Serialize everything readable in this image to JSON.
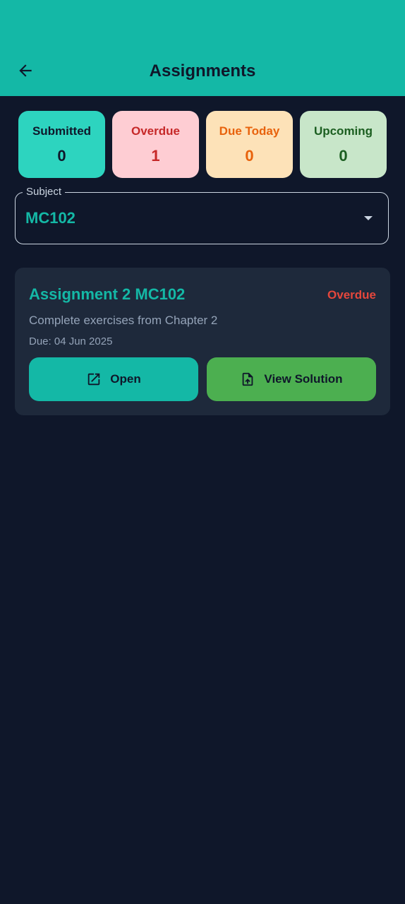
{
  "colors": {
    "appbar": "#14b8a6",
    "background": "#0f172a",
    "card": "#1e293b",
    "accent": "#14b8a6",
    "overdue": "#e5473c",
    "solution_button": "#4caf50"
  },
  "header": {
    "title": "Assignments",
    "back_icon": "arrow-left-icon"
  },
  "stats": [
    {
      "label": "Submitted",
      "value": "0",
      "bg": "#2dd4bf",
      "fg": "#0f172a"
    },
    {
      "label": "Overdue",
      "value": "1",
      "bg": "#fecdd3",
      "fg": "#c62828"
    },
    {
      "label": "Due Today",
      "value": "0",
      "bg": "#fde2b8",
      "fg": "#e8620c"
    },
    {
      "label": "Upcoming",
      "value": "0",
      "bg": "#c8e6c9",
      "fg": "#1b5e20"
    }
  ],
  "subject": {
    "label": "Subject",
    "value": "MC102",
    "icon": "dropdown-arrow-icon"
  },
  "assignments": [
    {
      "title": "Assignment 2 MC102",
      "status": "Overdue",
      "description": "Complete exercises from Chapter 2",
      "due": "Due: 04 Jun 2025",
      "open_label": "Open",
      "open_icon": "open-external-icon",
      "solution_label": "View Solution",
      "solution_icon": "file-upload-icon"
    }
  ]
}
